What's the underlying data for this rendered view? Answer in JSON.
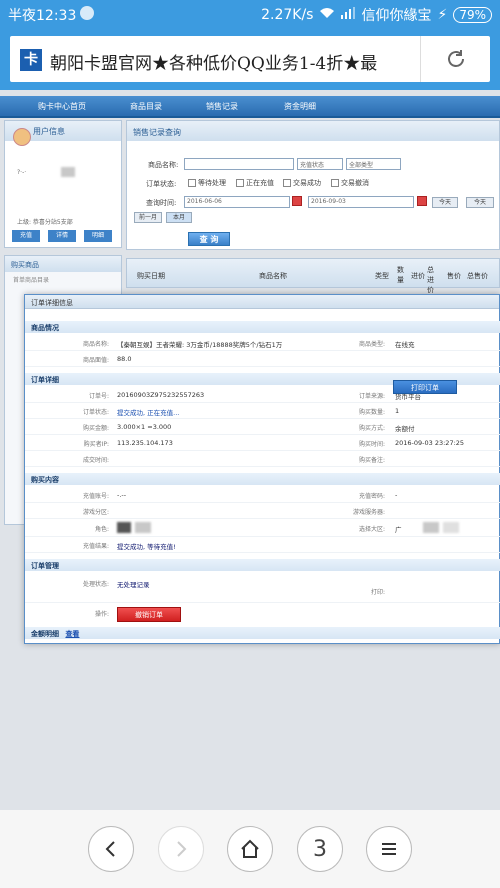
{
  "status_bar": {
    "time": "半夜12:33",
    "speed": "2.27K/s",
    "carrier": "信仰你緣宝",
    "battery": "79%"
  },
  "browser": {
    "favicon": "卡",
    "url": "朝阳卡盟官网★各种低价QQ业务1-4折★最"
  },
  "nav": {
    "items": [
      "购卡中心首页",
      "商品目录",
      "销售记录",
      "资金明细"
    ]
  },
  "user_panel": {
    "title": "用户信息",
    "line1": "?·-·",
    "line2": "上级: 恭喜分站5支部",
    "buttons": [
      "充值",
      "详情",
      "明细"
    ]
  },
  "left_menu": {
    "title": "购买商品",
    "items": [
      "首单商品目录"
    ]
  },
  "query": {
    "title": "销售记录查询",
    "label_name": "商品名称:",
    "select1": "充值状态",
    "select2": "全部类型",
    "label_status": "订单状态:",
    "status_options": [
      "等待处理",
      "正在充值",
      "交易成功",
      "交易撤消"
    ],
    "label_time": "查询时间:",
    "date_from": "2016-06-06",
    "date_to": "2016-09-03",
    "btn_today": "今天",
    "btn_right": "今天",
    "btn_prev": "前一月",
    "btn_this": "本月",
    "search_button": "查 询"
  },
  "table": {
    "headers": [
      "购买日期",
      "商品名称",
      "类型",
      "数量",
      "进价",
      "总进价",
      "售价",
      "总售价"
    ]
  },
  "modal": {
    "title": "订单详细信息",
    "sec_goods": "商品情况",
    "goods_name_label": "商品名称:",
    "goods_name": "【秦朝互娱】王者荣耀: 3万金币/18888奖牌5个/钻石1万",
    "goods_type_label": "商品类型:",
    "goods_type": "在线充",
    "goods_price_label": "商品面值:",
    "goods_price": "88.0",
    "sec_order": "订单详细",
    "order_no_label": "订单号:",
    "order_no": "20160903Z975232557263",
    "order_src_label": "订单来源:",
    "order_src": "货币平台",
    "order_status_label": "订单状态:",
    "order_status": "提交成功, 正在充值...",
    "buy_qty_label": "购买数量:",
    "buy_qty": "1",
    "amount_label": "购买金额:",
    "amount": "3.000×1 =3.000",
    "buy_type_label": "购买方式:",
    "buy_type": "余额付",
    "ip_label": "购买者IP:",
    "ip": "113.235.104.173",
    "buy_time_label": "购买时间:",
    "buy_time": "2016-09-03 23:27:25",
    "finish_time_label": "成交时间:",
    "remark_label": "购买备注:",
    "sec_content": "购买内容",
    "charge_acc_label": "充值账号:",
    "charge_acc": "-.--",
    "charge_pw_label": "充值密码:",
    "charge_pw": "-",
    "game_zone_label": "游戏分区:",
    "game_server_label": "游戏服务器:",
    "role_label": "角色:",
    "region_label": "选择大区:",
    "region": "广",
    "result_label": "充值结果:",
    "result": "提交成功, 等待充值!",
    "sec_manage": "订单管理",
    "proc_label": "处理状态:",
    "proc": "无处理记录",
    "print_label": "打印:",
    "print_button": "打印订单",
    "op_label": "操作:",
    "cancel_button": "撤销订单",
    "sec_funds": "金额明细",
    "funds_link": "查看"
  },
  "bottom_nav": {
    "tabs_count": "3"
  }
}
